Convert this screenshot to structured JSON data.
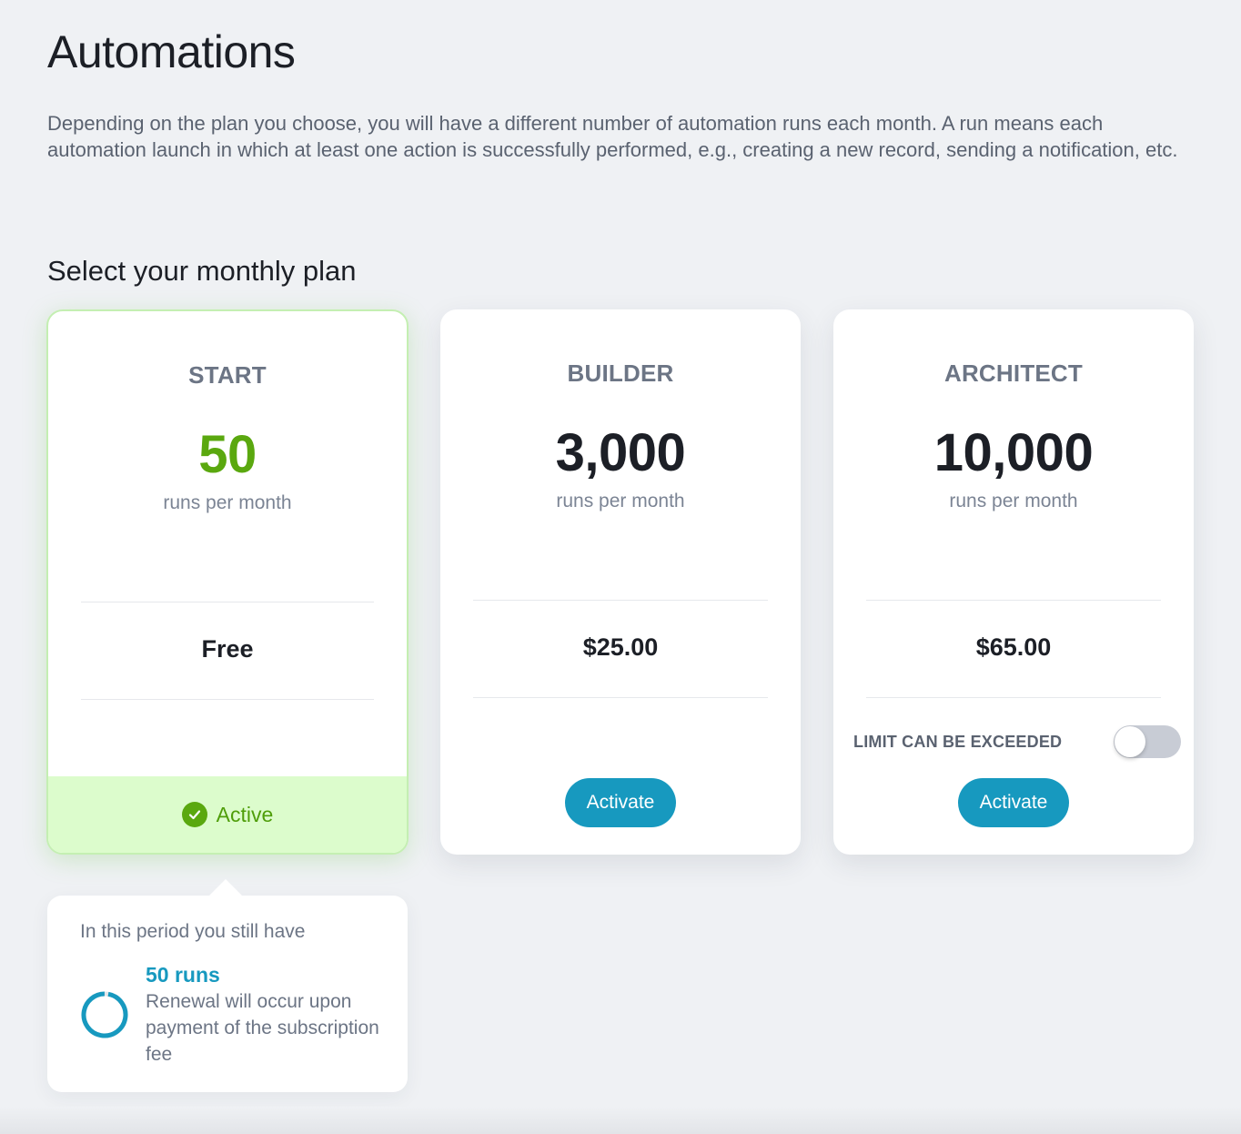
{
  "page": {
    "title": "Automations",
    "description": "Depending on the plan you choose, you will have a different number of automation runs each month. A run means each automation launch in which at least one action is successfully performed, e.g., creating a new record, sending a notification, etc.",
    "section_title": "Select your monthly plan"
  },
  "plans": [
    {
      "name": "START",
      "runs": "50",
      "runs_label": "runs per month",
      "price": "Free",
      "status": "Active",
      "active": true
    },
    {
      "name": "BUILDER",
      "runs": "3,000",
      "runs_label": "runs per month",
      "price": "$25.00",
      "button_label": "Activate",
      "active": false
    },
    {
      "name": "ARCHITECT",
      "runs": "10,000",
      "runs_label": "runs per month",
      "price": "$65.00",
      "limit_label": "LIMIT CAN BE EXCEEDED",
      "limit_enabled": false,
      "button_label": "Activate",
      "active": false
    }
  ],
  "usage": {
    "heading": "In this period you still have",
    "remaining": "50 runs",
    "note": "Renewal will occur upon payment of the subscription fee",
    "remaining_fraction": 1.0
  },
  "colors": {
    "accent": "#1799bf",
    "active_green": "#5aa80f",
    "active_bg": "#dcfccc"
  },
  "icons": {
    "active_status": "check-circle-icon",
    "usage_indicator": "progress-ring-icon"
  }
}
